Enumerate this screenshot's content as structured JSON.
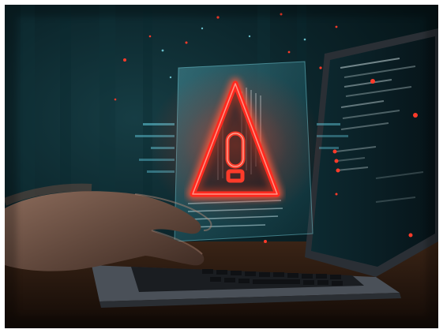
{
  "scene": {
    "subject": "hands-typing-on-laptop",
    "overlay": "holographic-warning-triangle",
    "icon": "warning-icon",
    "colors": {
      "background": "#0c262c",
      "hologram": "#4fb3c4",
      "warning": "#ff2a1f",
      "warning_glow": "#ff5a3c",
      "desk": "#2a1a12",
      "laptop": "#3a3f45",
      "screen": "#0a1e24"
    }
  }
}
